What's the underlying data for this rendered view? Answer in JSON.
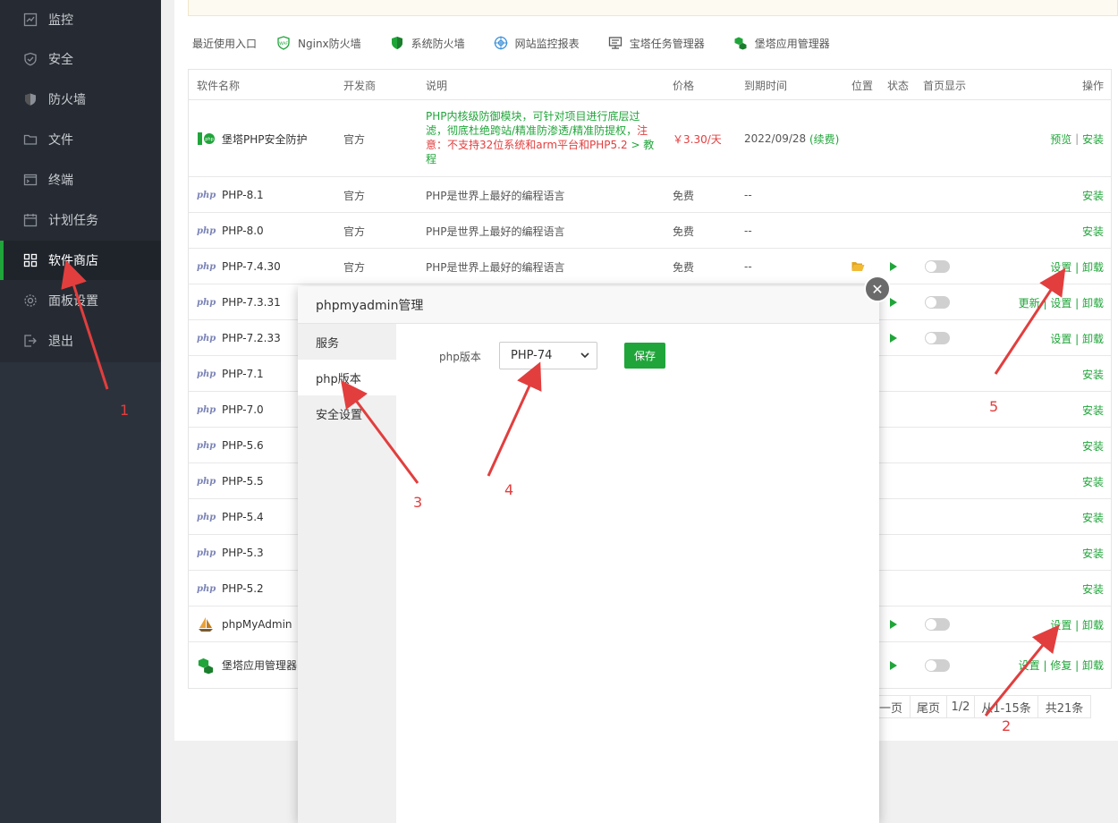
{
  "sidebar": {
    "items": [
      {
        "label": "监控",
        "icon": "monitor-icon"
      },
      {
        "label": "安全",
        "icon": "shield-check-icon"
      },
      {
        "label": "防火墙",
        "icon": "shield-icon"
      },
      {
        "label": "文件",
        "icon": "folder-icon"
      },
      {
        "label": "终端",
        "icon": "terminal-icon"
      },
      {
        "label": "计划任务",
        "icon": "calendar-icon"
      },
      {
        "label": "软件商店",
        "icon": "grid-icon",
        "active": true
      },
      {
        "label": "面板设置",
        "icon": "gear-icon"
      },
      {
        "label": "退出",
        "icon": "logout-icon"
      }
    ]
  },
  "recent": {
    "label": "最近使用入口",
    "links": [
      "Nginx防火墙",
      "系统防火墙",
      "网站监控报表",
      "宝塔任务管理器",
      "堡塔应用管理器"
    ]
  },
  "table": {
    "headers": [
      "软件名称",
      "开发商",
      "说明",
      "价格",
      "到期时间",
      "位置",
      "状态",
      "首页显示",
      "操作"
    ],
    "first_row": {
      "name": "堡塔PHP安全防护",
      "vendor": "官方",
      "desc_line1": "PHP内核级防御模块，可针对项目进行底层过",
      "desc_line2": "滤，彻底杜绝跨站/精准防渗透/精准防提权，",
      "desc_warn_a": "注",
      "desc_warn_b": "意：不支持32位系统和arm平台和PHP5.2",
      "desc_link_a": " > 教",
      "desc_link_b": "程",
      "price": "￥3.30/天",
      "expiry": "2022/09/28",
      "renew": "(续费)",
      "action1": "预览",
      "sep": "|",
      "action2": "安装"
    },
    "php_rows": [
      {
        "name": "PHP-8.1",
        "vendor": "官方",
        "desc": "PHP是世界上最好的编程语言",
        "price": "免费",
        "expiry": "--",
        "actions": "安装"
      },
      {
        "name": "PHP-8.0",
        "vendor": "官方",
        "desc": "PHP是世界上最好的编程语言",
        "price": "免费",
        "expiry": "--",
        "actions": "安装"
      },
      {
        "name": "PHP-7.4.30",
        "vendor": "官方",
        "desc": "PHP是世界上最好的编程语言",
        "price": "免费",
        "expiry": "--",
        "actions": "设置 | 卸载"
      },
      {
        "name": "PHP-7.3.31",
        "actions": "更新 | 设置 | 卸载"
      },
      {
        "name": "PHP-7.2.33",
        "actions": "设置 | 卸载"
      },
      {
        "name": "PHP-7.1",
        "actions": "安装"
      },
      {
        "name": "PHP-7.0",
        "actions": "安装"
      },
      {
        "name": "PHP-5.6",
        "actions": "安装"
      },
      {
        "name": "PHP-5.5",
        "actions": "安装"
      },
      {
        "name": "PHP-5.4",
        "actions": "安装"
      },
      {
        "name": "PHP-5.3",
        "actions": "安装"
      },
      {
        "name": "PHP-5.2",
        "actions": "安装"
      }
    ],
    "php_logo_text": "php",
    "pma_row": {
      "name": "phpMyAdmin",
      "actions": "设置 | 卸载"
    },
    "app_row": {
      "name": "堡塔应用管理器",
      "actions": "设置 | 修复 | 卸载"
    }
  },
  "pager": {
    "prev": "一页",
    "last": "尾页",
    "page": "1/2",
    "range": "从1-15条",
    "total": "共21条"
  },
  "modal": {
    "title": "phpmyadmin管理",
    "tabs": [
      "服务",
      "php版本",
      "安全设置"
    ],
    "active_tab": 1,
    "php_version_label": "php版本",
    "selected_version": "PHP-74",
    "save_label": "保存",
    "close_glyph": "✕"
  },
  "annotations": [
    "1",
    "2",
    "3",
    "4",
    "5"
  ],
  "colors": {
    "accent_green": "#20a53a",
    "sidebar_bg": "#2c323b",
    "warning_red": "#e23e3e",
    "arrow_red": "#e23e3e"
  }
}
